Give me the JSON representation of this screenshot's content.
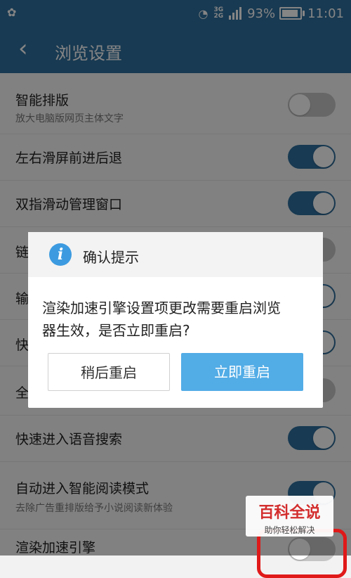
{
  "status": {
    "battery": "93%",
    "time": "11:01",
    "network": "3G",
    "network2": "2G",
    "battery_level": 0.93
  },
  "header": {
    "back_icon": "back-chevron-icon",
    "title": "浏览设置"
  },
  "settings": [
    {
      "title": "智能排版",
      "subtitle": "放大电脑版网页主体文字",
      "enabled": false
    },
    {
      "title": "左右滑屏前进后退",
      "subtitle": "",
      "enabled": true
    },
    {
      "title": "双指滑动管理窗口",
      "subtitle": "",
      "enabled": true
    },
    {
      "title": "链",
      "subtitle": "",
      "enabled": false
    },
    {
      "title": "输",
      "subtitle": "",
      "enabled": true
    },
    {
      "title": "快",
      "subtitle": "",
      "enabled": true
    },
    {
      "title": "全",
      "subtitle": "",
      "enabled": false
    },
    {
      "title": "快速进入语音搜索",
      "subtitle": "",
      "enabled": true
    },
    {
      "title": "自动进入智能阅读模式",
      "subtitle": "去除广告重排版给予小说阅读新体验",
      "enabled": true
    },
    {
      "title": "渲染加速引擎",
      "subtitle": "",
      "enabled": false
    }
  ],
  "dialog": {
    "title": "确认提示",
    "message_line1": "渲染加速引擎设置项更改需要重启浏览",
    "message_line2": "器生效，是否立即重启?",
    "later_label": "稍后重启",
    "now_label": "立即重启",
    "icon": "info-icon"
  },
  "watermark": {
    "text": "百科全说",
    "sub": "助你轻松解决"
  },
  "colors": {
    "header": "#2f6f9e",
    "toggle_on": "#2f6f9e",
    "toggle_off": "#c5c5c5",
    "primary_button": "#52ace6",
    "info_icon": "#3c9be0",
    "highlight": "#e01919"
  }
}
